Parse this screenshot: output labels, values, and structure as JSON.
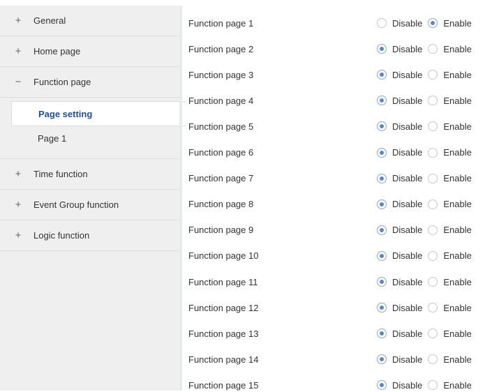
{
  "sidebar": {
    "items": [
      {
        "toggle": "+",
        "label": "General"
      },
      {
        "toggle": "+",
        "label": "Home page"
      },
      {
        "toggle": "−",
        "label": "Function page"
      },
      {
        "toggle": "+",
        "label": "Time function"
      },
      {
        "toggle": "+",
        "label": "Event Group function"
      },
      {
        "toggle": "+",
        "label": "Logic function"
      }
    ],
    "subitems": [
      {
        "label": "Page setting",
        "active": true
      },
      {
        "label": "Page 1",
        "active": false
      }
    ]
  },
  "options": {
    "disable": "Disable",
    "enable": "Enable"
  },
  "rows": [
    {
      "label": "Function page 1",
      "value": "Enable"
    },
    {
      "label": "Function page 2",
      "value": "Disable"
    },
    {
      "label": "Function page 3",
      "value": "Disable"
    },
    {
      "label": "Function page 4",
      "value": "Disable"
    },
    {
      "label": "Function page 5",
      "value": "Disable"
    },
    {
      "label": "Function page 6",
      "value": "Disable"
    },
    {
      "label": "Function page 7",
      "value": "Disable"
    },
    {
      "label": "Function page 8",
      "value": "Disable"
    },
    {
      "label": "Function page 9",
      "value": "Disable"
    },
    {
      "label": "Function page 10",
      "value": "Disable"
    },
    {
      "label": "Function page 11",
      "value": "Disable"
    },
    {
      "label": "Function page 12",
      "value": "Disable"
    },
    {
      "label": "Function page 13",
      "value": "Disable"
    },
    {
      "label": "Function page 14",
      "value": "Disable"
    },
    {
      "label": "Function page 15",
      "value": "Disable"
    }
  ]
}
